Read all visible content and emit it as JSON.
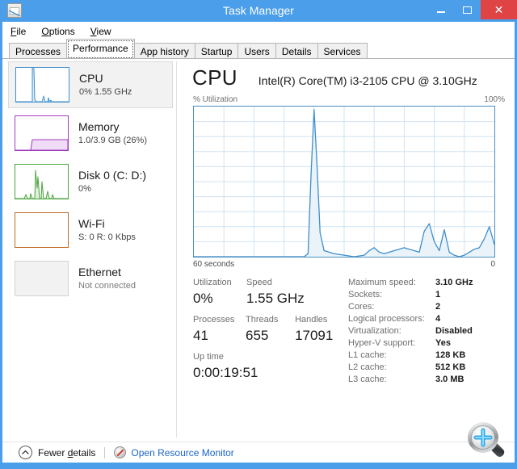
{
  "window": {
    "title": "Task Manager",
    "icon": "task-manager-icon",
    "controls": {
      "minimize": "minimize-icon",
      "maximize": "maximize-icon",
      "close": "close-icon"
    },
    "titlebar_color": "#4a9eea",
    "close_color": "#e04343"
  },
  "menu": {
    "items": [
      {
        "accel": "F",
        "rest": "ile"
      },
      {
        "accel": "O",
        "rest": "ptions"
      },
      {
        "accel": "V",
        "rest": "iew"
      }
    ]
  },
  "tabs": [
    {
      "label": "Processes",
      "active": false
    },
    {
      "label": "Performance",
      "active": true
    },
    {
      "label": "App history",
      "active": false
    },
    {
      "label": "Startup",
      "active": false
    },
    {
      "label": "Users",
      "active": false
    },
    {
      "label": "Details",
      "active": false
    },
    {
      "label": "Services",
      "active": false
    }
  ],
  "sidebar": {
    "items": [
      {
        "name": "cpu",
        "title": "CPU",
        "subtitle": "0%  1.55 GHz",
        "selected": true,
        "color": "#3f8fcc",
        "muted": false
      },
      {
        "name": "memory",
        "title": "Memory",
        "subtitle": "1.0/3.9 GB (26%)",
        "selected": false,
        "color": "#a23bbf",
        "muted": false
      },
      {
        "name": "disk-0",
        "title": "Disk 0 (C: D:)",
        "subtitle": "0%",
        "selected": false,
        "color": "#4aa53c",
        "muted": false
      },
      {
        "name": "wi-fi",
        "title": "Wi-Fi",
        "subtitle": "S: 0 R: 0 Kbps",
        "selected": false,
        "color": "#c06822",
        "muted": false
      },
      {
        "name": "ethernet",
        "title": "Ethernet",
        "subtitle": "Not connected",
        "selected": false,
        "color": "#d9d9d9",
        "muted": true
      }
    ]
  },
  "main": {
    "heading": "CPU",
    "model": "Intel(R) Core(TM) i3-2105 CPU @ 3.10GHz",
    "y_axis_label": "% Utilization",
    "y_axis_max": "100%",
    "x_axis_left": "60 seconds",
    "x_axis_right": "0",
    "stats": {
      "row1": [
        {
          "label": "Utilization",
          "value": "0%"
        },
        {
          "label": "Speed",
          "value": "1.55 GHz"
        }
      ],
      "row2": [
        {
          "label": "Processes",
          "value": "41"
        },
        {
          "label": "Threads",
          "value": "655"
        },
        {
          "label": "Handles",
          "value": "17091"
        }
      ],
      "row3": [
        {
          "label": "Up time",
          "value": "0:00:19:51"
        }
      ]
    },
    "specs": [
      {
        "label": "Maximum speed:",
        "value": "3.10 GHz"
      },
      {
        "label": "Sockets:",
        "value": "1"
      },
      {
        "label": "Cores:",
        "value": "2"
      },
      {
        "label": "Logical processors:",
        "value": "4"
      },
      {
        "label": "Virtualization:",
        "value": "Disabled"
      },
      {
        "label": "Hyper-V support:",
        "value": "Yes"
      },
      {
        "label": "L1 cache:",
        "value": "128 KB"
      },
      {
        "label": "L2 cache:",
        "value": "512 KB"
      },
      {
        "label": "L3 cache:",
        "value": "3.0 MB"
      }
    ]
  },
  "chart_data": {
    "type": "area",
    "title": "CPU % Utilization",
    "xlabel": "60 seconds",
    "ylabel": "% Utilization",
    "ylim": [
      0,
      100
    ],
    "xlim": [
      60,
      0
    ],
    "grid": true,
    "grid_cols": 10,
    "grid_rows": 10,
    "line_color": "#3f8fcc",
    "fill_color": "#eaf3fa",
    "legend": "none",
    "x": [
      60,
      58,
      56,
      54,
      52,
      50,
      48,
      46,
      44,
      42,
      40,
      38,
      37.2,
      36.6,
      36,
      35.4,
      34.8,
      34,
      32,
      30,
      28,
      26,
      25,
      24,
      23,
      22,
      21,
      20,
      19,
      18,
      17,
      16,
      15,
      14,
      13,
      12,
      11,
      10,
      9,
      8,
      7,
      6,
      5,
      4,
      3,
      2,
      1,
      0
    ],
    "values": [
      0,
      0,
      0,
      0,
      0,
      0,
      0,
      0,
      0,
      0,
      0,
      0,
      2,
      55,
      98,
      60,
      16,
      4,
      2,
      1,
      0,
      1,
      4,
      6,
      3,
      2,
      3,
      4,
      5,
      6,
      5,
      4,
      3,
      17,
      22,
      10,
      4,
      18,
      3,
      1,
      0,
      1,
      3,
      5,
      6,
      12,
      20,
      8,
      4,
      3,
      2,
      1,
      0
    ]
  },
  "bottombar": {
    "fewer_details": {
      "pre": "Fewer ",
      "accel": "d",
      "post": "etails"
    },
    "resource_monitor": "Open Resource Monitor",
    "link_color": "#1a64c8"
  },
  "watermark": {
    "icon": "magnifier-zoom-in-icon"
  }
}
